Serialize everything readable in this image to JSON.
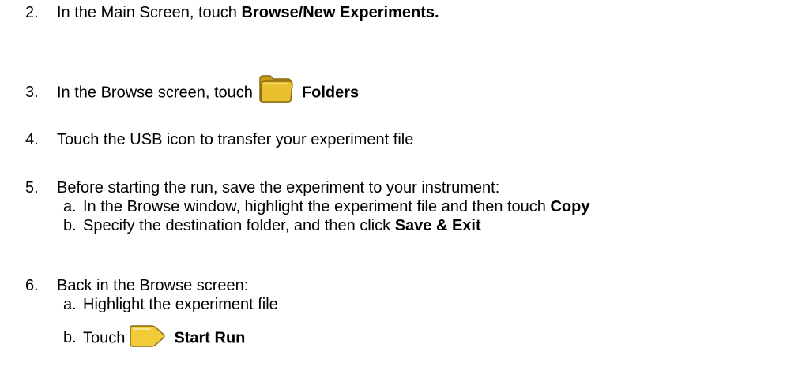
{
  "steps": {
    "s2": {
      "number": "2.",
      "text": "In the Main Screen, touch ",
      "bold": "Browse/New Experiments."
    },
    "s3": {
      "number": "3.",
      "text": "In the Browse screen, touch",
      "icon": "folder-icon",
      "bold": "Folders"
    },
    "s4": {
      "number": "4.",
      "text": "Touch the USB icon to transfer your experiment file"
    },
    "s5": {
      "number": "5.",
      "text": "Before starting the run, save the experiment to your instrument:",
      "a": {
        "letter": "a.",
        "text": "In the Browse window, highlight the experiment file and then touch ",
        "bold": "Copy"
      },
      "b": {
        "letter": "b.",
        "text": "Specify the destination folder, and then click ",
        "bold": "Save & Exit"
      }
    },
    "s6": {
      "number": "6.",
      "text": "Back in the Browse screen:",
      "a": {
        "letter": "a.",
        "text": "Highlight the experiment file"
      },
      "b": {
        "letter": "b.",
        "text": "Touch",
        "icon": "play-icon",
        "bold": "Start Run"
      }
    }
  },
  "colors": {
    "folder_fill": "#E8C030",
    "folder_stroke": "#8A6A10",
    "play_fill": "#F2CC38",
    "play_stroke": "#8A6A10"
  }
}
